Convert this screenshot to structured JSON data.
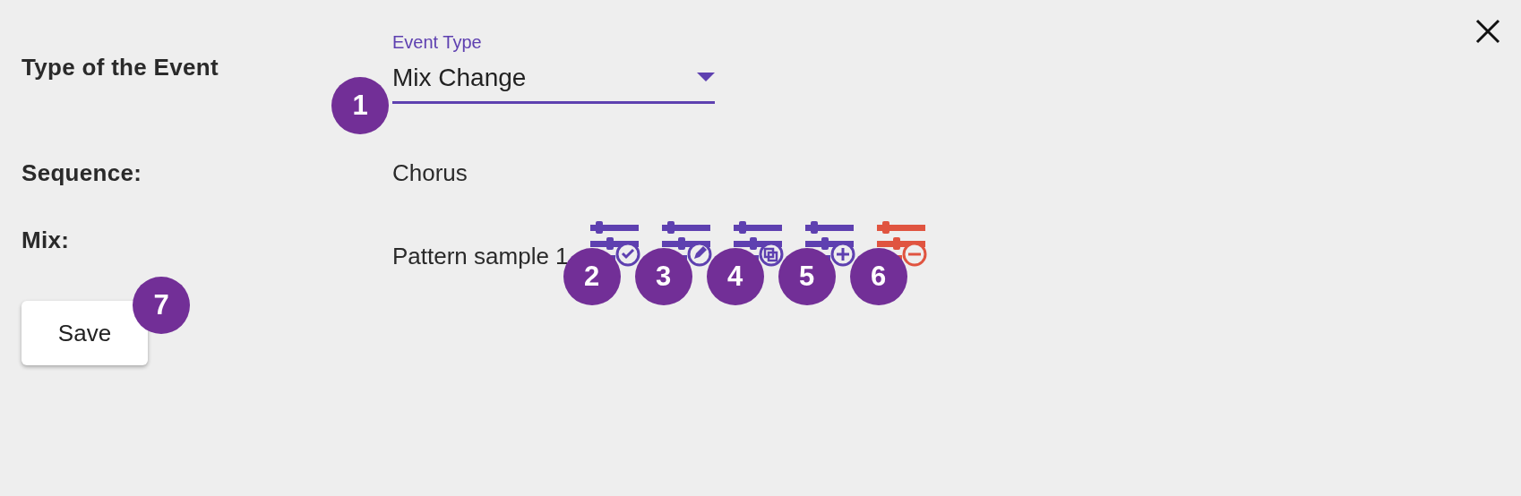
{
  "fields": [
    {
      "kind": "select",
      "label": "Type of the Event",
      "floating_label": "Event Type",
      "value": "Mix Change",
      "badge": "1"
    },
    {
      "kind": "text",
      "label": "Sequence:",
      "value": "Chorus"
    },
    {
      "kind": "mix",
      "label": "Mix:",
      "value": "Pattern sample 1",
      "actions": [
        {
          "kind": "check",
          "color": "#5e40b0",
          "badge": "2"
        },
        {
          "kind": "edit",
          "color": "#5e40b0",
          "badge": "3"
        },
        {
          "kind": "copy",
          "color": "#5e40b0",
          "badge": "4"
        },
        {
          "kind": "add",
          "color": "#5e40b0",
          "badge": "5"
        },
        {
          "kind": "remove",
          "color": "#e05440",
          "badge": "6"
        }
      ]
    }
  ],
  "save": {
    "label": "Save",
    "badge": "7"
  }
}
